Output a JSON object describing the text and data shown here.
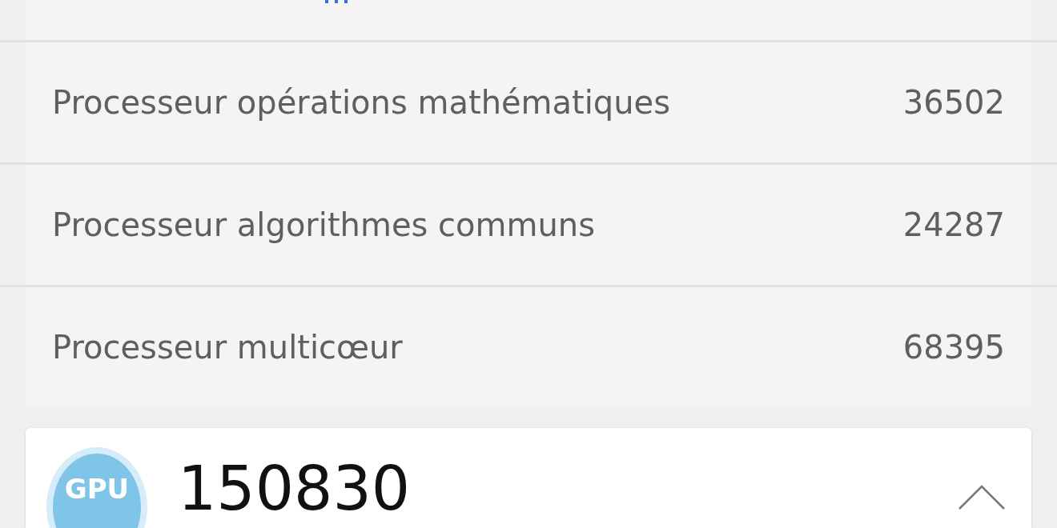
{
  "scores": [
    {
      "label": "Processeur opérations mathématiques",
      "value": "36502"
    },
    {
      "label": "Processeur algorithmes communs",
      "value": "24287"
    },
    {
      "label": "Processeur multicœur",
      "value": "68395"
    }
  ],
  "gpu_card": {
    "badge": "GPU",
    "score": "150830",
    "expanded": true
  }
}
